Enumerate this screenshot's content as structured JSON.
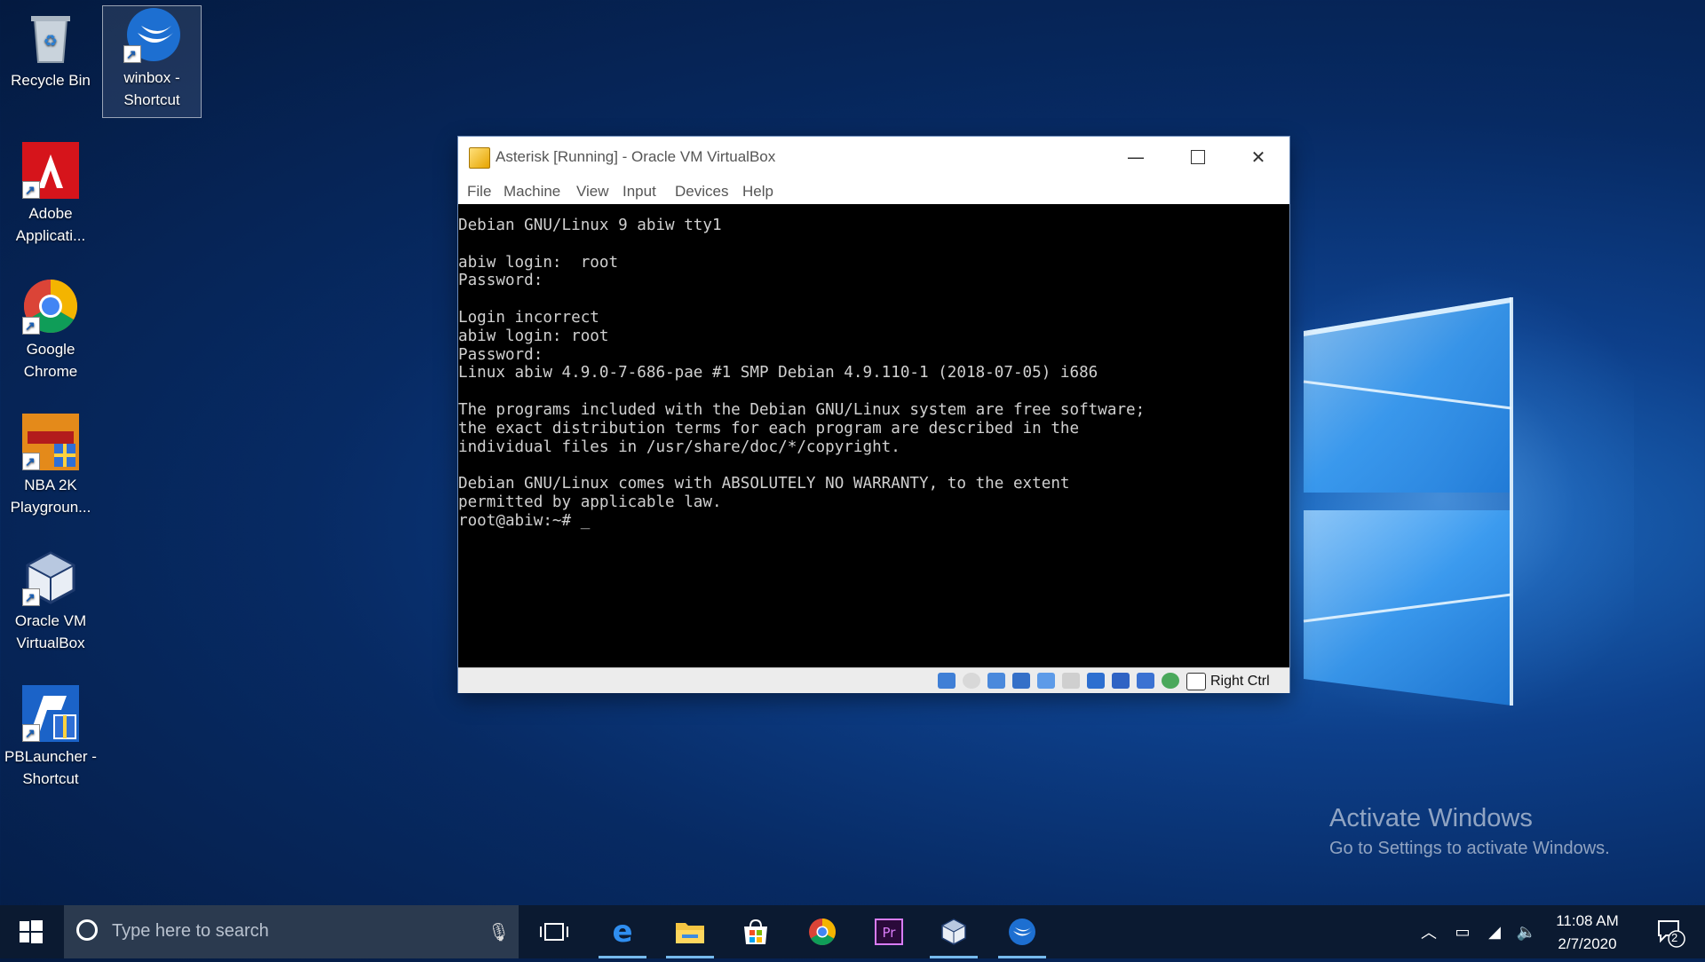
{
  "desktop": {
    "icons": [
      {
        "label": "Recycle Bin"
      },
      {
        "label": "winbox -\nShortcut"
      },
      {
        "label": "Adobe\nApplicati..."
      },
      {
        "label": "Google\nChrome"
      },
      {
        "label": "NBA 2K\nPlaygroun..."
      },
      {
        "label": "Oracle VM\nVirtualBox"
      },
      {
        "label": "PBLauncher -\nShortcut"
      }
    ]
  },
  "vbox": {
    "title": "Asterisk [Running] - Oracle VM VirtualBox",
    "menu": [
      "File",
      "Machine",
      "View",
      "Input",
      "Devices",
      "Help"
    ],
    "console_text": "Debian GNU/Linux 9 abiw tty1\n\nabiw login:  root\nPassword:\n\nLogin incorrect\nabiw login: root\nPassword:\nLinux abiw 4.9.0-7-686-pae #1 SMP Debian 4.9.110-1 (2018-07-05) i686\n\nThe programs included with the Debian GNU/Linux system are free software;\nthe exact distribution terms for each program are described in the\nindividual files in /usr/share/doc/*/copyright.\n\nDebian GNU/Linux comes with ABSOLUTELY NO WARRANTY, to the extent\npermitted by applicable law.\nroot@abiw:~# _",
    "host_key": "Right Ctrl"
  },
  "watermark": {
    "title": "Activate Windows",
    "subtitle": "Go to Settings to activate Windows."
  },
  "taskbar": {
    "search_placeholder": "Type here to search",
    "time": "11:08 AM",
    "date": "2/7/2020",
    "notification_count": "2"
  }
}
